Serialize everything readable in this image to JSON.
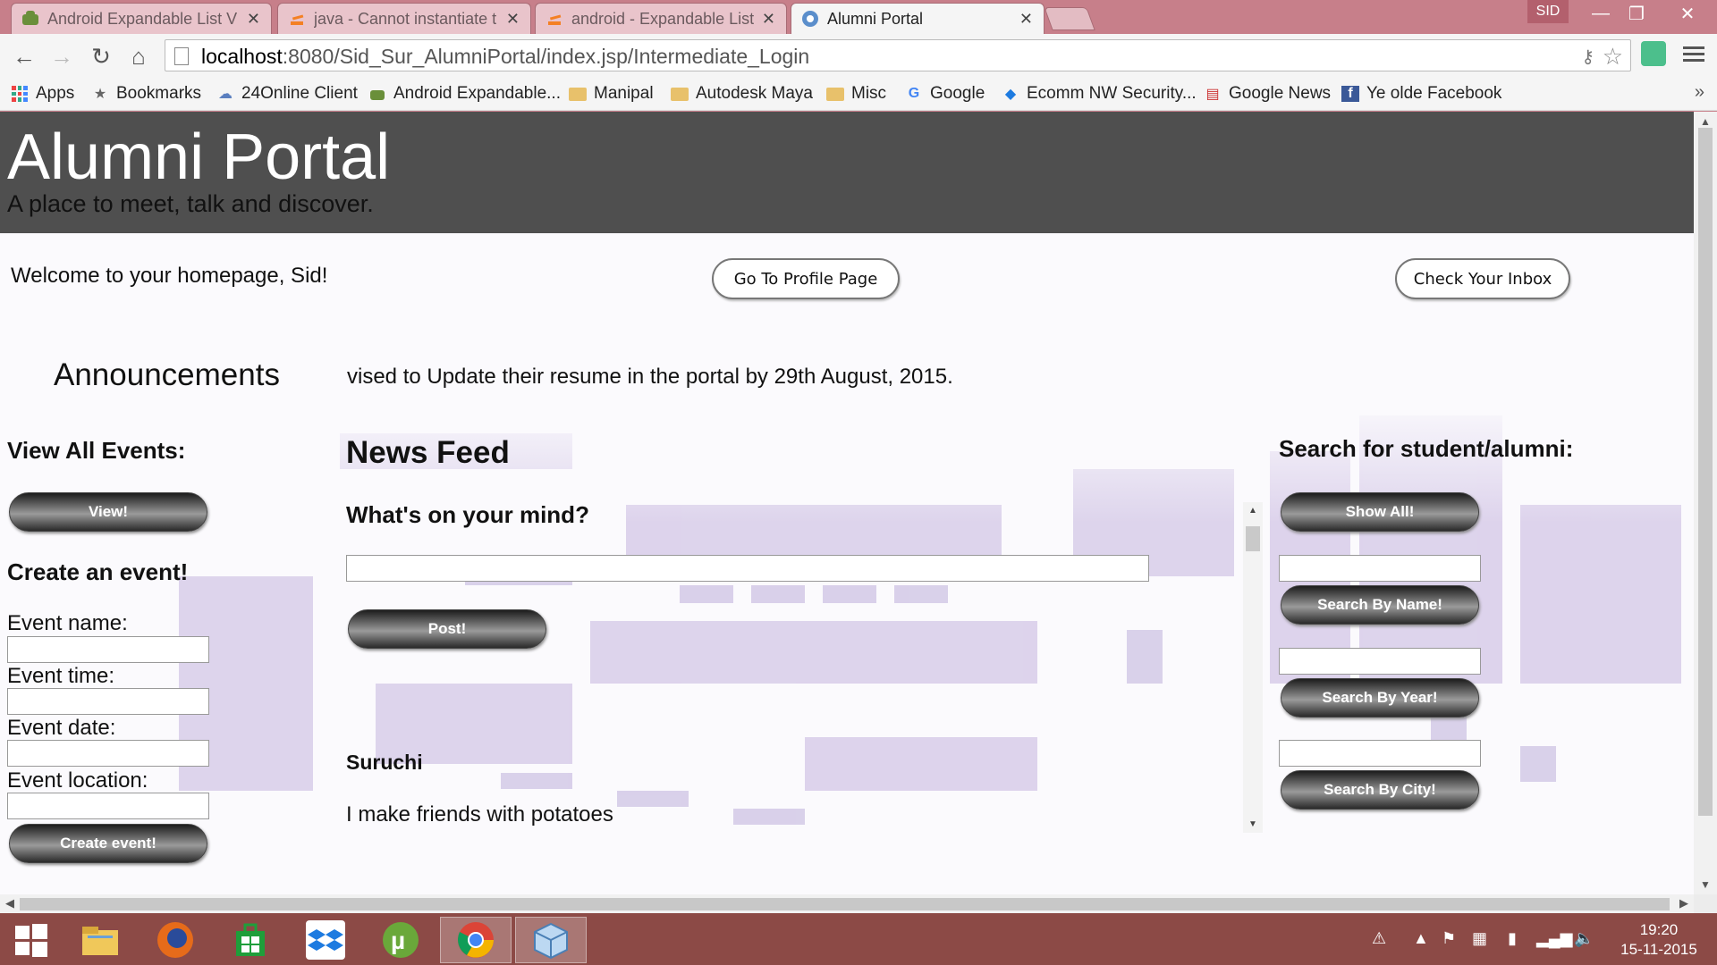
{
  "browser": {
    "tabs": [
      {
        "label": "Android Expandable List V",
        "active": false
      },
      {
        "label": "java - Cannot instantiate t",
        "active": false
      },
      {
        "label": "android - Expandable List",
        "active": false
      },
      {
        "label": "Alumni Portal",
        "active": true
      }
    ],
    "user_badge": "SID",
    "url_host": "localhost",
    "url_path": ":8080/Sid_Sur_AlumniPortal/index.jsp/Intermediate_Login",
    "bookmarks": [
      {
        "label": "Apps",
        "icon": "apps-icon"
      },
      {
        "label": "Bookmarks",
        "icon": "star-icon"
      },
      {
        "label": "24Online Client",
        "icon": "cloud-icon"
      },
      {
        "label": "Android Expandable...",
        "icon": "android-icon"
      },
      {
        "label": "Manipal",
        "icon": "folder-icon"
      },
      {
        "label": "Autodesk Maya",
        "icon": "folder-icon"
      },
      {
        "label": "Misc",
        "icon": "folder-icon"
      },
      {
        "label": "Google",
        "icon": "google-icon"
      },
      {
        "label": "Ecomm NW Security...",
        "icon": "dropbox-icon"
      },
      {
        "label": "Google News",
        "icon": "news-icon"
      },
      {
        "label": "Ye olde Facebook",
        "icon": "facebook-icon"
      }
    ]
  },
  "page": {
    "title": "Alumni Portal",
    "tagline": "A place to meet, talk and discover.",
    "welcome": "Welcome to your homepage, Sid!",
    "profile_button": "Go To Profile Page",
    "inbox_button": "Check Your Inbox",
    "announcements_title": "Announcements",
    "announcement_text": "vised to Update their resume in the portal by 29th August, 2015.",
    "left": {
      "events_heading": "View All Events:",
      "view_button": "View!",
      "create_heading": "Create an event!",
      "name_label": "Event name:",
      "time_label": "Event time:",
      "date_label": "Event date:",
      "location_label": "Event location:",
      "create_button": "Create event!"
    },
    "feed": {
      "heading": "News Feed",
      "prompt": "What's on your mind?",
      "post_button": "Post!",
      "author": "Suruchi",
      "message": "I make friends with potatoes"
    },
    "right": {
      "heading": "Search for student/alumni:",
      "show_all": "Show All!",
      "by_name": "Search By Name!",
      "by_year": "Search By Year!",
      "by_city": "Search By City!"
    }
  },
  "taskbar": {
    "time": "19:20",
    "date": "15-11-2015"
  },
  "colors": {
    "header_bg": "#4f4f4f",
    "chrome_frame": "#c77f8a",
    "taskbar": "#8c4a46"
  }
}
